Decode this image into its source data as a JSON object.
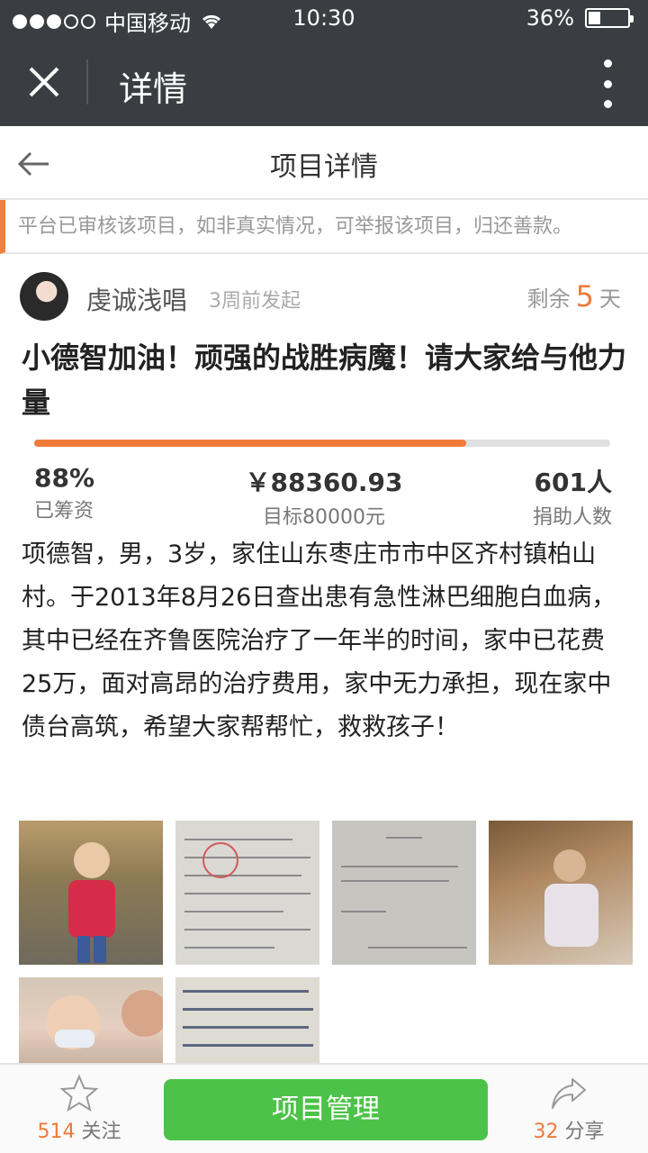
{
  "status_bar": {
    "carrier": "中国移动",
    "time": "10:30",
    "battery": "36%",
    "battery_level": 0.36
  },
  "title_bar": {
    "title": "详情"
  },
  "page_header": {
    "title": "项目详情"
  },
  "notice": "平台已审核该项目，如非真实情况，可举报该项目，归还善款。",
  "author": {
    "name": "虔诚浅唱",
    "posted": "3周前发起",
    "remain_prefix": "剩余",
    "remain_days": "5",
    "remain_suffix": "天"
  },
  "project": {
    "title": "小德智加油！顽强的战胜病魔！请大家给与他力量",
    "progress": 0.75,
    "stats": {
      "percent": "88%",
      "percent_label": "已筹资",
      "amount": "￥88360.93",
      "target": "目标80000元",
      "donors": "601人",
      "donors_label": "捐助人数"
    },
    "description": "项德智，男，3岁，家住山东枣庄市市中区齐村镇柏山村。于2013年8月26日查出患有急性淋巴细胞白血病，其中已经在齐鲁医院治疗了一年半的时间，家中已花费25万，面对高昂的治疗费用，家中无力承担，现在家中债台高筑，希望大家帮帮忙，救救孩子！"
  },
  "gallery": [
    "child-photo",
    "medical-record-photo",
    "certificate-photo",
    "child-hospital-photo",
    "child-mother-photo",
    "handwritten-letter-photo"
  ],
  "bottom_bar": {
    "follow_count": "514",
    "follow_label": "关注",
    "manage_label": "项目管理",
    "share_count": "32",
    "share_label": "分享"
  },
  "colors": {
    "accent": "#f07a3a",
    "green": "#4cc348",
    "dark_bar": "#3a3e42"
  }
}
